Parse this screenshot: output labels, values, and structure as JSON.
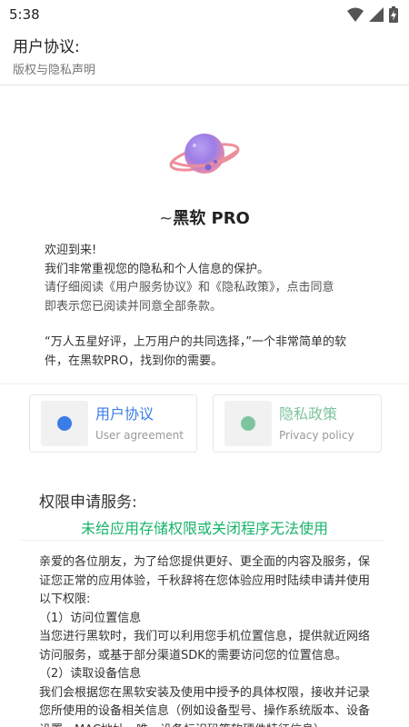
{
  "status_bar": {
    "time": "5:38",
    "icons": [
      "wifi-icon",
      "signal-icon",
      "battery-charging-icon"
    ]
  },
  "header": {
    "title": "用户协议:",
    "subtitle": "版权与隐私声明"
  },
  "app": {
    "logo": "planet-logo",
    "name_mark": "~",
    "name": "黑软 PRO"
  },
  "welcome": {
    "line1": "欢迎到来!",
    "line2": "我们非常重视您的隐私和个人信息的保护。",
    "line3": "请仔细阅读《用户服务协议》和《隐私政策》，点击同意",
    "line4": "即表示您已阅读并同意全部条款。"
  },
  "tagline": "“万人五星好评，上万用户的共同选择，”一个非常简单的软件，在黑软PRO，找到你的需要。",
  "cards": [
    {
      "title": "用户协议",
      "subtitle": "User agreement",
      "color": "#3a7de8"
    },
    {
      "title": "隐私政策",
      "subtitle": "Privacy policy",
      "color": "#7dc49e"
    }
  ],
  "permissions": {
    "title": "权限申请服务:",
    "warning": "未给应用存储权限或关闭程序无法使用",
    "intro": "亲爱的各位朋友，为了给您提供更好、更全面的内容及服务，保证您正常的应用体验，千秋辞将在您体验应用时陆续申请并使用以下权限:",
    "item1_title": "（1）访问位置信息",
    "item1_body": "当您进行黑软时，我们可以利用您手机位置信息，提供就近网络访问服务，或基于部分渠道SDK的需要访问您的位置信息。",
    "item2_title": "（2）读取设备信息",
    "item2_body": "我们会根据您在黑软安装及使用中授予的具体权限，接收并记录您所使用的设备相关信息（例如设备型号、操作系统版本、设备设置、MAC地址、唯一设备标识码等软硬件特征信息）"
  },
  "colors": {
    "accent_blue": "#3a7de8",
    "accent_green": "#18b46b",
    "privacy_green": "#7dc49e"
  }
}
